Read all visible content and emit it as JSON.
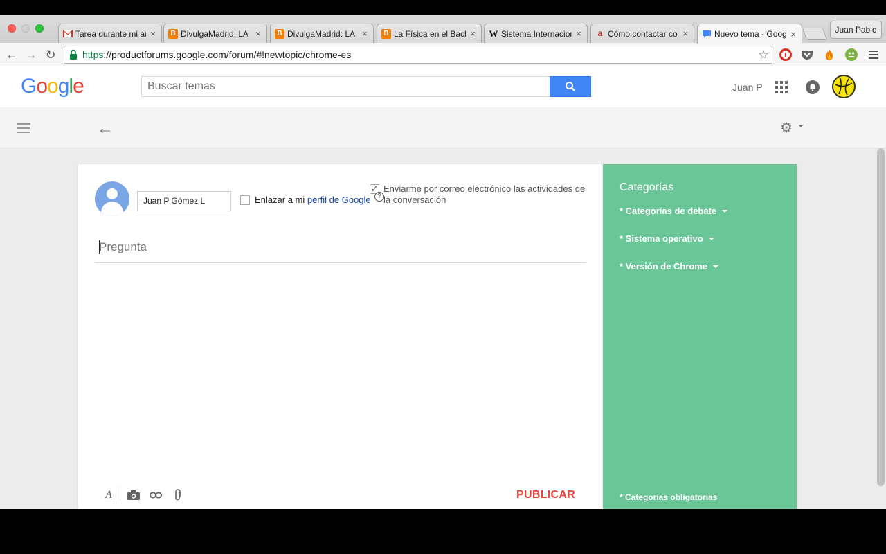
{
  "browser": {
    "tabs": [
      {
        "title": "Tarea durante mi au",
        "favicon": "gmail-icon",
        "color": "#d93025"
      },
      {
        "title": "DivulgaMadrid: LA",
        "favicon": "blogger-icon",
        "color": "#f57d00"
      },
      {
        "title": "DivulgaMadrid: LA",
        "favicon": "blogger-icon",
        "color": "#f57d00"
      },
      {
        "title": "La Física en el Bach",
        "favicon": "blogger-icon",
        "color": "#f57d00"
      },
      {
        "title": "Sistema Internacion",
        "favicon": "wikipedia-icon",
        "color": "#000000"
      },
      {
        "title": "Cómo contactar co",
        "favicon": "rae-icon",
        "color": "#b32b2b"
      },
      {
        "title": "Nuevo tema - Goog",
        "favicon": "forum-icon",
        "color": "#4285f4"
      }
    ],
    "tab_close": "×",
    "profile": "Juan Pablo",
    "url_scheme": "https",
    "url_rest": "://productforums.google.com/forum/#!newtopic/chrome-es"
  },
  "header": {
    "logo": [
      "G",
      "o",
      "o",
      "g",
      "l",
      "e"
    ],
    "search_placeholder": "Buscar temas",
    "username": "Juan P"
  },
  "composer": {
    "author_name": "Juan P Gómez L",
    "link_text": "Enlazar a mi ",
    "link_anchor": "perfil de Google",
    "email_text": "Enviarme por correo electrónico las actividades de la conversación",
    "email_checked": true,
    "question_placeholder": "Pregunta",
    "publish_label": "PUBLICAR"
  },
  "categories": {
    "title": "Categorías",
    "items": [
      "* Categorías de debate",
      "* Sistema operativo",
      "* Versión de Chrome"
    ],
    "footer": "* Categorías obligatorias"
  },
  "colors": {
    "accent": "#4285f4",
    "publish": "#e8453c",
    "sidebar": "#6ac597"
  }
}
